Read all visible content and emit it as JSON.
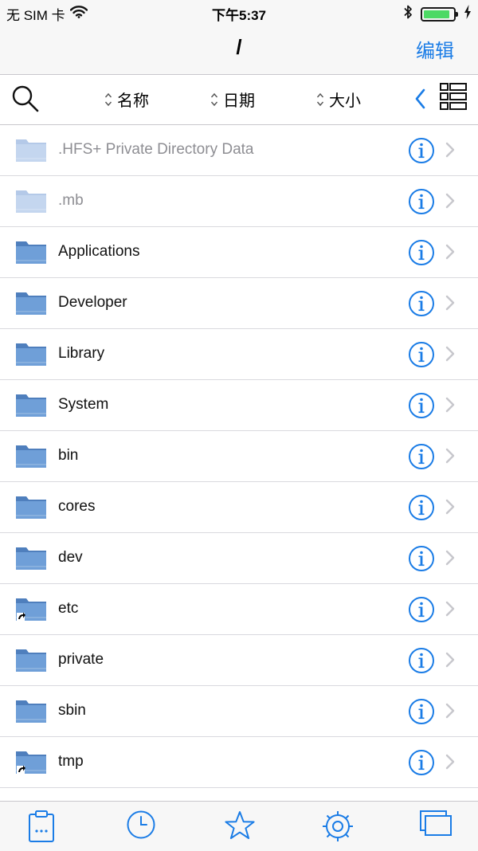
{
  "status_bar": {
    "carrier": "无 SIM 卡",
    "time": "下午5:37",
    "battery_level": 0.9,
    "icons": [
      "wifi-icon",
      "bluetooth-icon",
      "battery-icon",
      "charging-icon"
    ]
  },
  "nav": {
    "title": "/",
    "edit_label": "编辑"
  },
  "toolbar": {
    "sort_name": "名称",
    "sort_date": "日期",
    "sort_size": "大小",
    "icons": [
      "search-icon",
      "sort-arrows-icon",
      "chevron-left-icon",
      "list-view-icon"
    ]
  },
  "files": [
    {
      "name": ".HFS+ Private Directory Data",
      "hidden": true,
      "symlink": false
    },
    {
      "name": ".mb",
      "hidden": true,
      "symlink": false
    },
    {
      "name": "Applications",
      "hidden": false,
      "symlink": false
    },
    {
      "name": "Developer",
      "hidden": false,
      "symlink": false
    },
    {
      "name": "Library",
      "hidden": false,
      "symlink": false
    },
    {
      "name": "System",
      "hidden": false,
      "symlink": false
    },
    {
      "name": "bin",
      "hidden": false,
      "symlink": false
    },
    {
      "name": "cores",
      "hidden": false,
      "symlink": false
    },
    {
      "name": "dev",
      "hidden": false,
      "symlink": false
    },
    {
      "name": "etc",
      "hidden": false,
      "symlink": true
    },
    {
      "name": "private",
      "hidden": false,
      "symlink": false
    },
    {
      "name": "sbin",
      "hidden": false,
      "symlink": false
    },
    {
      "name": "tmp",
      "hidden": false,
      "symlink": true
    },
    {
      "name": "",
      "hidden": false,
      "symlink": false
    }
  ],
  "tab_bar": {
    "icons": [
      "clipboard-icon",
      "clock-icon",
      "star-icon",
      "gear-icon",
      "windows-icon"
    ]
  },
  "colors": {
    "accent": "#1a7ce6",
    "folder": "#6f9fd8",
    "folder_dim": "#c4d6ef",
    "battery": "#4cd964"
  }
}
